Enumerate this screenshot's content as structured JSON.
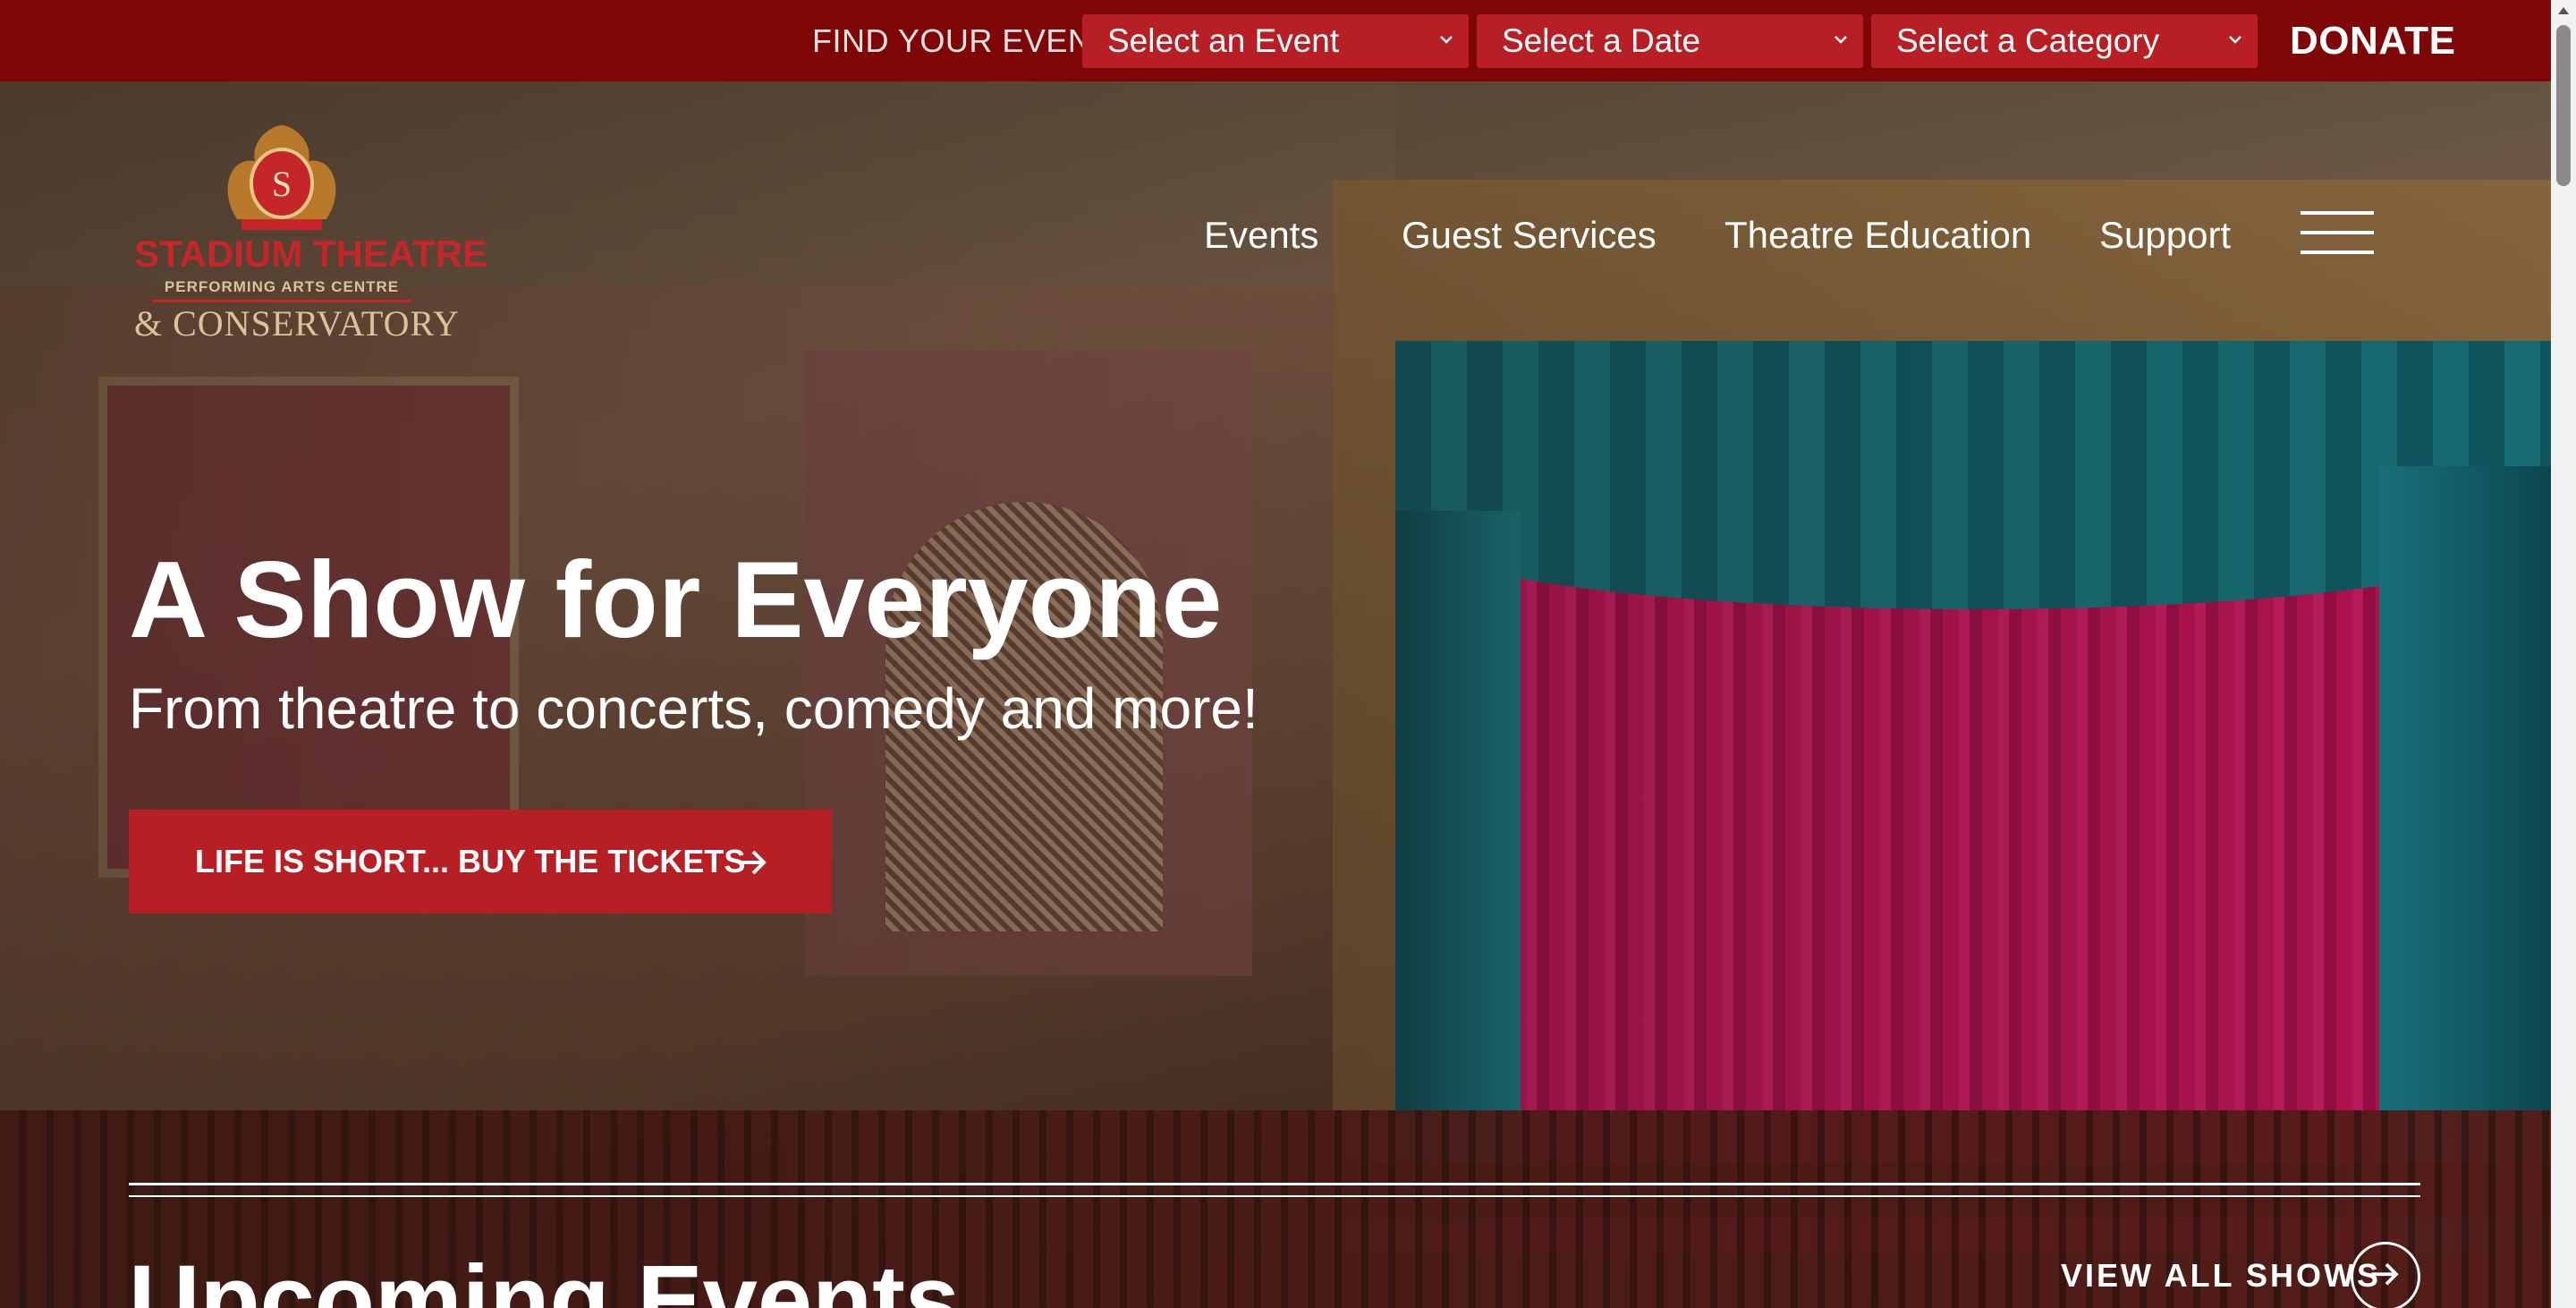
{
  "topbar": {
    "find_label": "FIND YOUR EVENT",
    "select_event": "Select an Event",
    "select_date": "Select a Date",
    "select_category": "Select a Category",
    "donate_label": "DONATE"
  },
  "logo": {
    "line1": "STADIUM THEATRE",
    "line2": "PERFORMING ARTS CENTRE",
    "line3": "& CONSERVATORY"
  },
  "nav": {
    "items": [
      {
        "label": "Events"
      },
      {
        "label": "Guest Services"
      },
      {
        "label": "Theatre Education"
      },
      {
        "label": "Support"
      }
    ]
  },
  "hero": {
    "title": "A Show for Everyone",
    "subtitle": "From theatre to concerts, comedy and more!",
    "cta_label": "LIFE IS SHORT... BUY THE TICKETS"
  },
  "section": {
    "heading": "Upcoming Events",
    "view_all_label": "VIEW ALL SHOWS"
  },
  "colors": {
    "topbar_bg": "#7e0606",
    "accent_red": "#b81f24",
    "text_white": "#ffffff"
  }
}
